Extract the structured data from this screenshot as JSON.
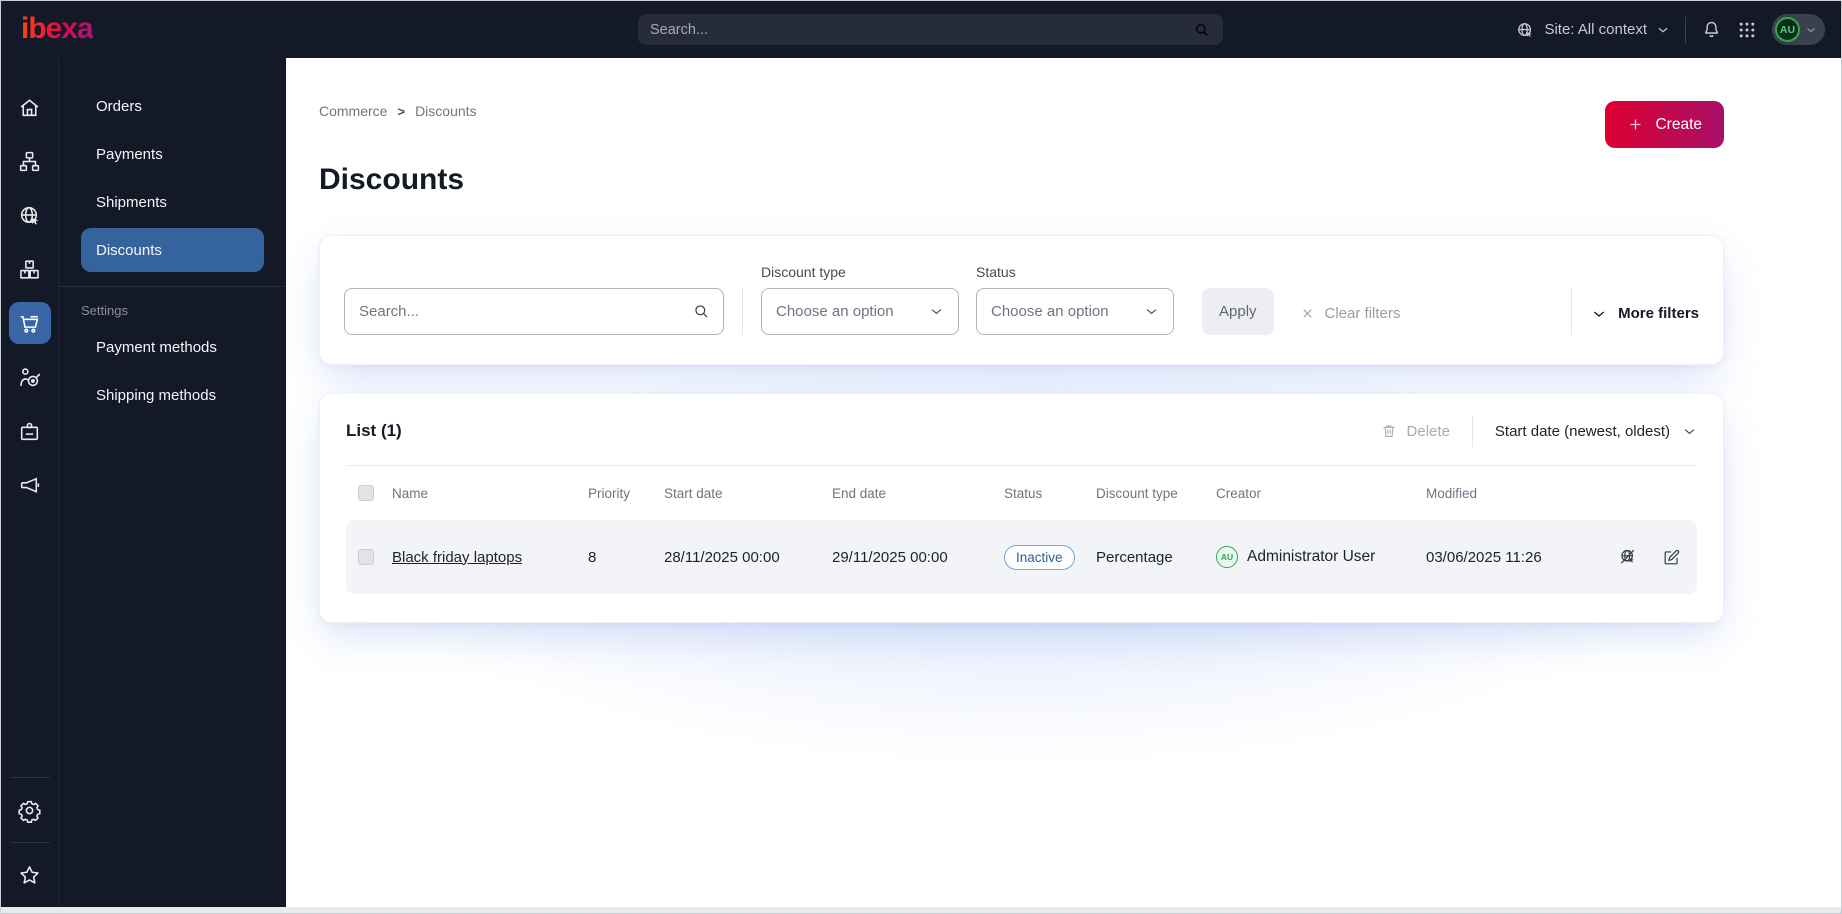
{
  "topbar": {
    "logo": "ibexa",
    "search_placeholder": "Search...",
    "site_context": "Site: All context"
  },
  "user": {
    "initials": "AU"
  },
  "sidebar": {
    "icons": [
      "home-icon",
      "content-tree-icon",
      "site-globe-icon",
      "products-boxes-icon",
      "commerce-cart-icon",
      "audience-target-icon",
      "id-badge-icon",
      "megaphone-icon",
      "gear-icon",
      "star-icon"
    ],
    "active_icon": "commerce-cart-icon"
  },
  "menu": {
    "items": [
      {
        "label": "Orders",
        "active": false
      },
      {
        "label": "Payments",
        "active": false
      },
      {
        "label": "Shipments",
        "active": false
      },
      {
        "label": "Discounts",
        "active": true
      }
    ],
    "settings": {
      "label": "Settings",
      "items": [
        {
          "label": "Payment methods"
        },
        {
          "label": "Shipping methods"
        }
      ]
    }
  },
  "breadcrumb": {
    "items": [
      "Commerce",
      "Discounts"
    ],
    "separator": ">"
  },
  "page": {
    "title": "Discounts",
    "create_label": "Create"
  },
  "filters": {
    "search_placeholder": "Search...",
    "discount_type_label": "Discount type",
    "discount_type_value": "Choose an option",
    "status_label": "Status",
    "status_value": "Choose an option",
    "apply_label": "Apply",
    "clear_label": "Clear filters",
    "more_label": "More filters"
  },
  "list": {
    "title": "List (1)",
    "delete_label": "Delete",
    "sort_label": "Start date (newest, oldest)",
    "table": {
      "columns": [
        "Name",
        "Priority",
        "Start date",
        "End date",
        "Status",
        "Discount type",
        "Creator",
        "Modified"
      ],
      "rows": [
        {
          "name": "Black friday laptops",
          "priority": "8",
          "start_date": "28/11/2025 00:00",
          "end_date": "29/11/2025 00:00",
          "status": "Inactive",
          "discount_type": "Percentage",
          "creator_initials": "AU",
          "creator": "Administrator User",
          "modified": "03/06/2025 11:26"
        }
      ]
    }
  },
  "colors": {
    "topbar_bg": "#141927",
    "brand_red": "#DB0032",
    "brand_gradient_end": "#A80F66",
    "active_blue": "#35639E",
    "status_inactive_border": "#71A6DE",
    "status_inactive_text": "#31608F",
    "creator_green": "#2FA84F",
    "row_bg": "#F3F4F8"
  }
}
